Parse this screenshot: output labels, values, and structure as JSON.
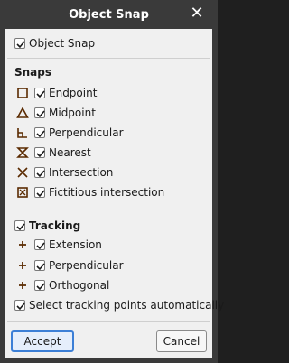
{
  "window": {
    "title": "Object Snap"
  },
  "master": {
    "label": "Object Snap",
    "checked": true
  },
  "snaps": {
    "heading": "Snaps",
    "items": [
      {
        "label": "Endpoint",
        "icon": "square-icon",
        "checked": true
      },
      {
        "label": "Midpoint",
        "icon": "triangle-icon",
        "checked": true
      },
      {
        "label": "Perpendicular",
        "icon": "perpendicular-icon",
        "checked": true
      },
      {
        "label": "Nearest",
        "icon": "hourglass-icon",
        "checked": true
      },
      {
        "label": "Intersection",
        "icon": "cross-icon",
        "checked": true
      },
      {
        "label": "Fictitious intersection",
        "icon": "boxed-cross-icon",
        "checked": true
      }
    ]
  },
  "tracking": {
    "label": "Tracking",
    "checked": true,
    "items": [
      {
        "label": "Extension",
        "icon": "plus-icon",
        "checked": true
      },
      {
        "label": "Perpendicular",
        "icon": "plus-icon",
        "checked": true
      },
      {
        "label": "Orthogonal",
        "icon": "plus-icon",
        "checked": true
      }
    ]
  },
  "auto_select": {
    "label": "Select tracking points automatically",
    "checked": true
  },
  "buttons": {
    "accept": "Accept",
    "cancel": "Cancel"
  },
  "colors": {
    "snap_icon": "#5a2a00",
    "accent": "#3c7fd6"
  }
}
